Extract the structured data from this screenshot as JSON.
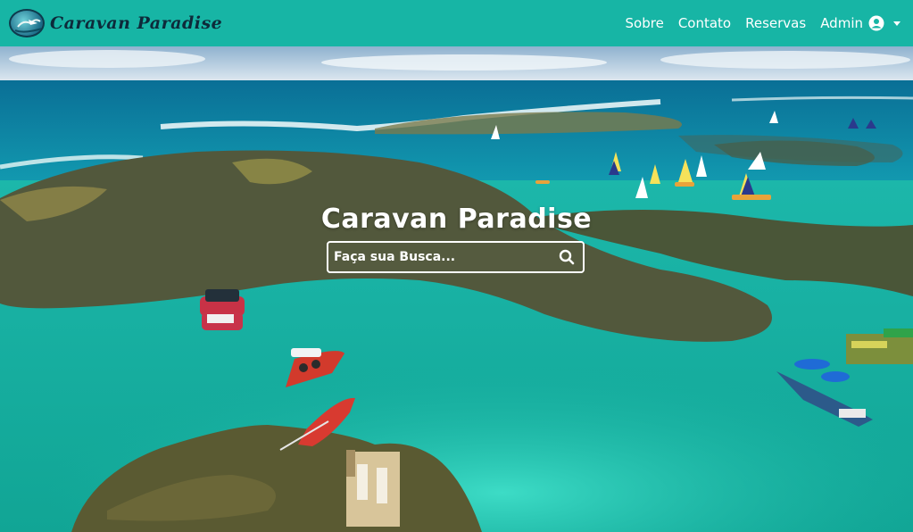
{
  "brand": {
    "name": "Caravan Paradise",
    "logo_icon": "globe-plane-icon"
  },
  "nav": {
    "items": [
      {
        "label": "Sobre"
      },
      {
        "label": "Contato"
      },
      {
        "label": "Reservas"
      }
    ],
    "admin": {
      "label": "Admin",
      "icon": "user-circle-icon",
      "dropdown_icon": "caret-down-icon"
    }
  },
  "hero": {
    "title": "Caravan Paradise",
    "search": {
      "placeholder": "Faça sua Busca...",
      "value": "",
      "icon": "search-icon"
    }
  },
  "colors": {
    "navbar": "#17b5a5",
    "brand_text": "#0d2a3a",
    "nav_text": "#ffffff",
    "sea": "#1fc4b0",
    "reef": "#4f5a3a"
  }
}
